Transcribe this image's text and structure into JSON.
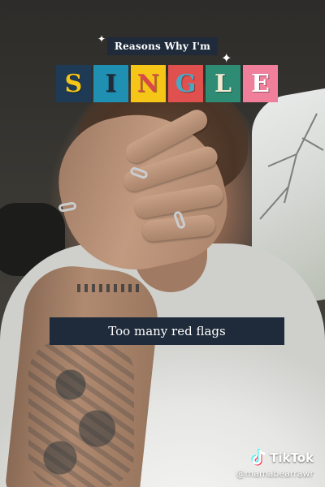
{
  "overlay": {
    "subtitle": "Reasons Why I'm",
    "word_letters": [
      {
        "char": "S",
        "bg": "#1f3a55",
        "fg": "#f5c518"
      },
      {
        "char": "I",
        "bg": "#1f8fb2",
        "fg": "#1f2a3a"
      },
      {
        "char": "N",
        "bg": "#f5c518",
        "fg": "#d84a4a"
      },
      {
        "char": "G",
        "bg": "#e0504f",
        "fg": "#49a9c4"
      },
      {
        "char": "L",
        "bg": "#2e8b74",
        "fg": "#f2e9d0"
      },
      {
        "char": "E",
        "bg": "#ef7f9a",
        "fg": "#ffffff"
      }
    ],
    "caption": "Too many red flags"
  },
  "watermark": {
    "brand": "TikTok",
    "handle": "@mamabearrawr",
    "logo_icon": "tiktok-logo-icon"
  },
  "colors": {
    "label_bg": "#1f2a3a",
    "label_text": "#ffffff"
  }
}
